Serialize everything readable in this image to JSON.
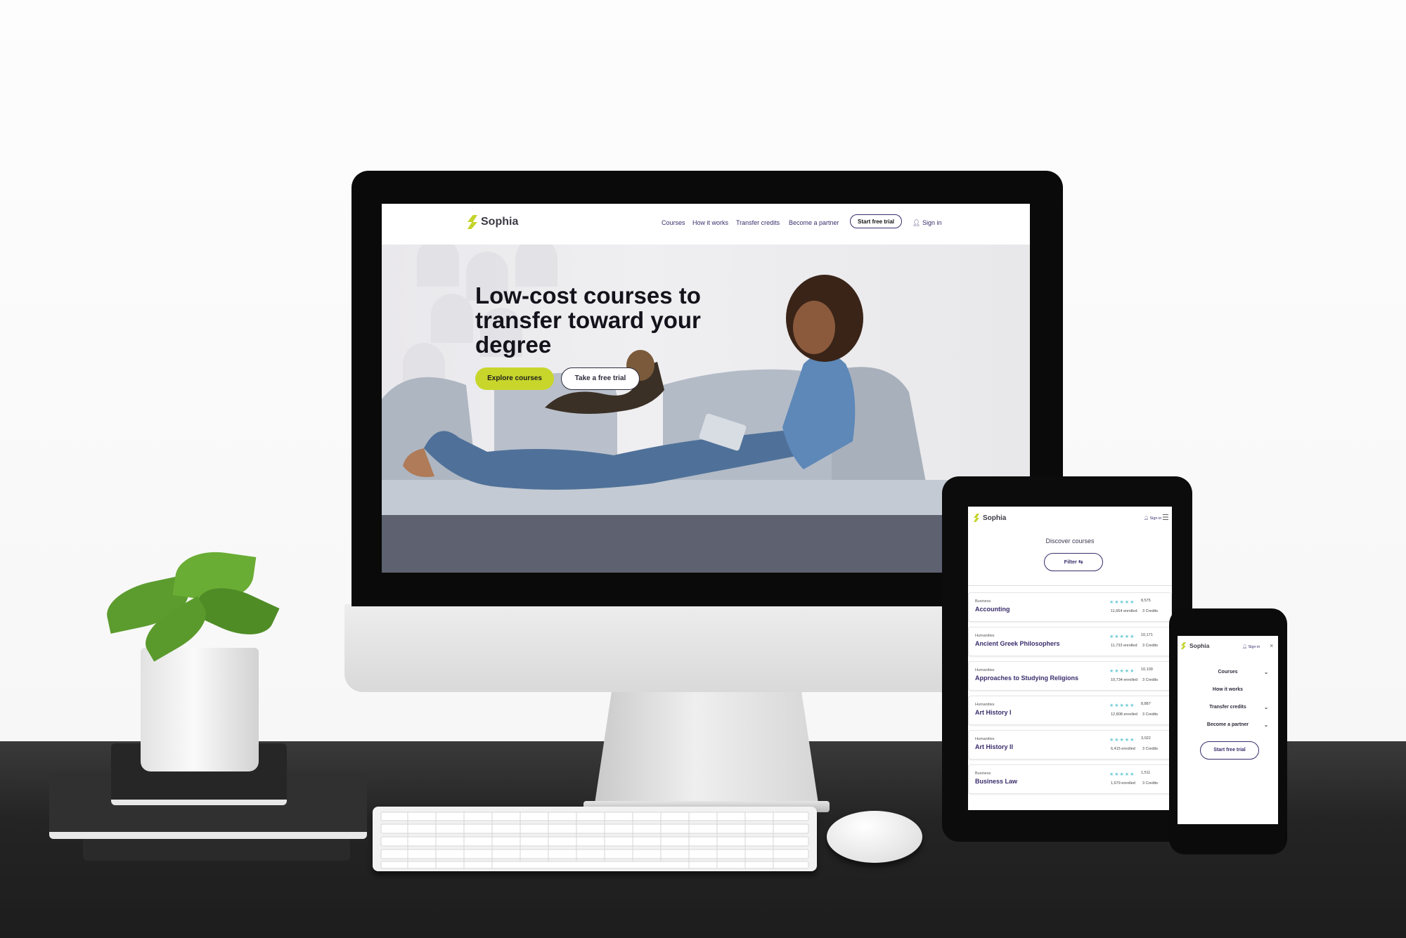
{
  "brand": {
    "name": "Sophia"
  },
  "desktop": {
    "nav": {
      "links": [
        "Courses",
        "How it works",
        "Transfer credits",
        "Become a partner"
      ],
      "cta": "Start free trial",
      "sign_in": "Sign in"
    },
    "hero": {
      "title": "Low-cost courses to transfer toward your degree",
      "primary_button": "Explore courses",
      "secondary_button": "Take a free trial"
    }
  },
  "tablet": {
    "sign_in": "Sign in",
    "title": "Discover courses",
    "filter": "Filter",
    "courses": [
      {
        "category": "Business",
        "name": "Accounting",
        "ratings": "8,575",
        "enrolled": "11,654 enrolled",
        "credits": "3 Credits"
      },
      {
        "category": "Humanities",
        "name": "Ancient Greek Philosophers",
        "ratings": "10,171",
        "enrolled": "11,733 enrolled",
        "credits": "3 Credits"
      },
      {
        "category": "Humanities",
        "name": "Approaches to Studying Religions",
        "ratings": "10,109",
        "enrolled": "10,734 enrolled",
        "credits": "3 Credits"
      },
      {
        "category": "Humanities",
        "name": "Art History I",
        "ratings": "8,887",
        "enrolled": "12,808 enrolled",
        "credits": "3 Credits"
      },
      {
        "category": "Humanities",
        "name": "Art History II",
        "ratings": "3,022",
        "enrolled": "6,415 enrolled",
        "credits": "3 Credits"
      },
      {
        "category": "Business",
        "name": "Business Law",
        "ratings": "1,511",
        "enrolled": "1,679 enrolled",
        "credits": "3 Credits"
      }
    ]
  },
  "phone": {
    "sign_in": "Sign in",
    "menu": [
      "Courses",
      "How it works",
      "Transfer credits",
      "Become a partner"
    ],
    "cta": "Start free trial"
  },
  "colors": {
    "accent": "#c8d62c",
    "brand_purple": "#3a2d6b",
    "star": "#6fcbd6",
    "desk": "#1f1f1f"
  },
  "icons": [
    "user-icon",
    "menu-icon",
    "close-icon",
    "filter-icon",
    "chevron-down-icon",
    "star-icon"
  ]
}
